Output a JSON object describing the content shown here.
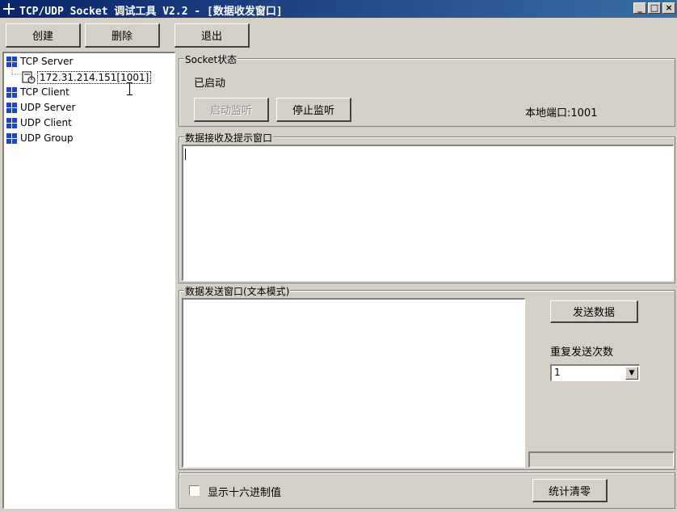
{
  "window": {
    "title": "TCP/UDP Socket 调试工具 V2.2 - [数据收发窗口]",
    "minimize": "_",
    "maximize": "□",
    "close": "×"
  },
  "toolbar": {
    "create_label": "创建",
    "delete_label": "删除",
    "exit_label": "退出"
  },
  "tree": {
    "tcp_server": "TCP Server",
    "tcp_server_child": "172.31.214.151[1001]",
    "tcp_client": "TCP Client",
    "udp_server": "UDP Server",
    "udp_client": "UDP Client",
    "udp_group": "UDP Group"
  },
  "socket_status": {
    "legend": "Socket状态",
    "state_text": "已启动",
    "start_listen_label": "启动监听",
    "stop_listen_label": "停止监听",
    "local_port_text": "本地端口:1001"
  },
  "receive": {
    "legend": "数据接收及提示窗口"
  },
  "send": {
    "legend": "数据发送窗口(文本模式)",
    "send_button_label": "发送数据",
    "repeat_label": "重复发送次数",
    "repeat_value": "1"
  },
  "footer": {
    "hex_label": "显示十六进制值",
    "clear_stats_label": "统计清零"
  }
}
